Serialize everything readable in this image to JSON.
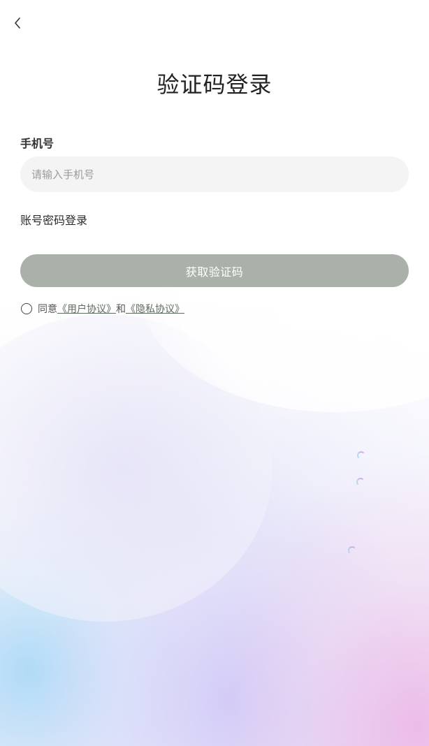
{
  "header": {
    "back_icon": "chevron-left-icon",
    "title": "验证码登录"
  },
  "form": {
    "phone_label": "手机号",
    "phone_placeholder": "请输入手机号",
    "phone_value": "",
    "switch_mode_label": "账号密码登录",
    "submit_label": "获取验证码",
    "submit_color": "#a9b1a9"
  },
  "agreement": {
    "checked": false,
    "prefix": "同意",
    "user_agreement": "《用户协议》",
    "connector": "和",
    "privacy_policy": "《隐私协议》"
  }
}
